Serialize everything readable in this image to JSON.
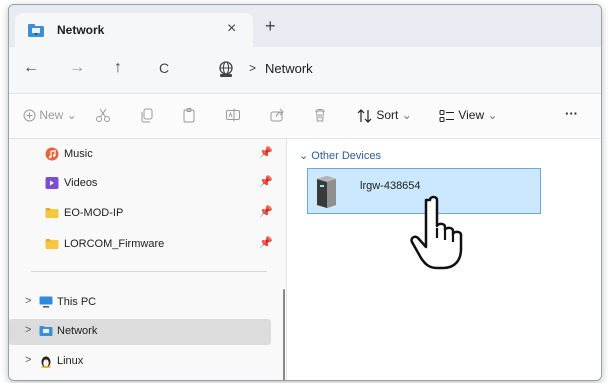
{
  "tab": {
    "title": "Network",
    "close": "×",
    "new_tab": "+"
  },
  "address": {
    "back": "←",
    "forward": "→",
    "up": "↑",
    "refresh": "C",
    "separator": ">",
    "path": "Network"
  },
  "commandbar": {
    "new_label": "New",
    "sort_label": "Sort",
    "view_label": "View",
    "more_label": "···",
    "dropdown": "⌄"
  },
  "sidebar": {
    "pinned": [
      {
        "label": "Music",
        "pin": "📌"
      },
      {
        "label": "Videos",
        "pin": "📌"
      },
      {
        "label": "EO-MOD-IP",
        "pin": "📌"
      },
      {
        "label": "LORCOM_Firmware",
        "pin": "📌"
      }
    ],
    "tree": [
      {
        "label": "This PC",
        "chev": ">"
      },
      {
        "label": "Network",
        "chev": ">"
      },
      {
        "label": "Linux",
        "chev": ">"
      }
    ]
  },
  "content": {
    "group_header": "Other Devices",
    "group_chev": "⌄",
    "device": {
      "label": "lrgw-438654"
    }
  },
  "colors": {
    "accent": "#0067c0",
    "selection": "#cce8ff",
    "selection_border": "#6aa8e0"
  }
}
